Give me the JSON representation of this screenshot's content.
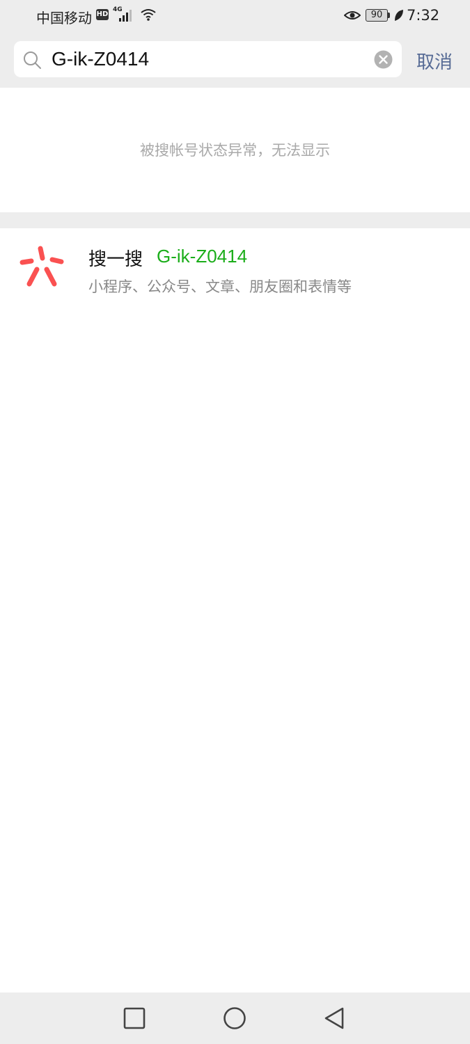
{
  "status_bar": {
    "carrier": "中国移动",
    "hd_badge": "HD",
    "network_type": "4G",
    "battery_level": "90",
    "time": "7:32"
  },
  "search": {
    "query": "G-ik-Z0414",
    "cancel_label": "取消"
  },
  "notice": {
    "text": "被搜帐号状态异常，无法显示"
  },
  "sousou": {
    "title": "搜一搜",
    "query": "G-ik-Z0414",
    "subtitle": "小程序、公众号、文章、朋友圈和表情等",
    "logo_color": "#fa5151"
  },
  "colors": {
    "accent_link": "#576b95",
    "highlight_green": "#1aad19",
    "background_gray": "#ededed"
  },
  "icons": {
    "search": "search-icon",
    "clear": "clear-icon",
    "recent_apps": "square-icon",
    "home": "circle-icon",
    "back": "triangle-back-icon"
  }
}
